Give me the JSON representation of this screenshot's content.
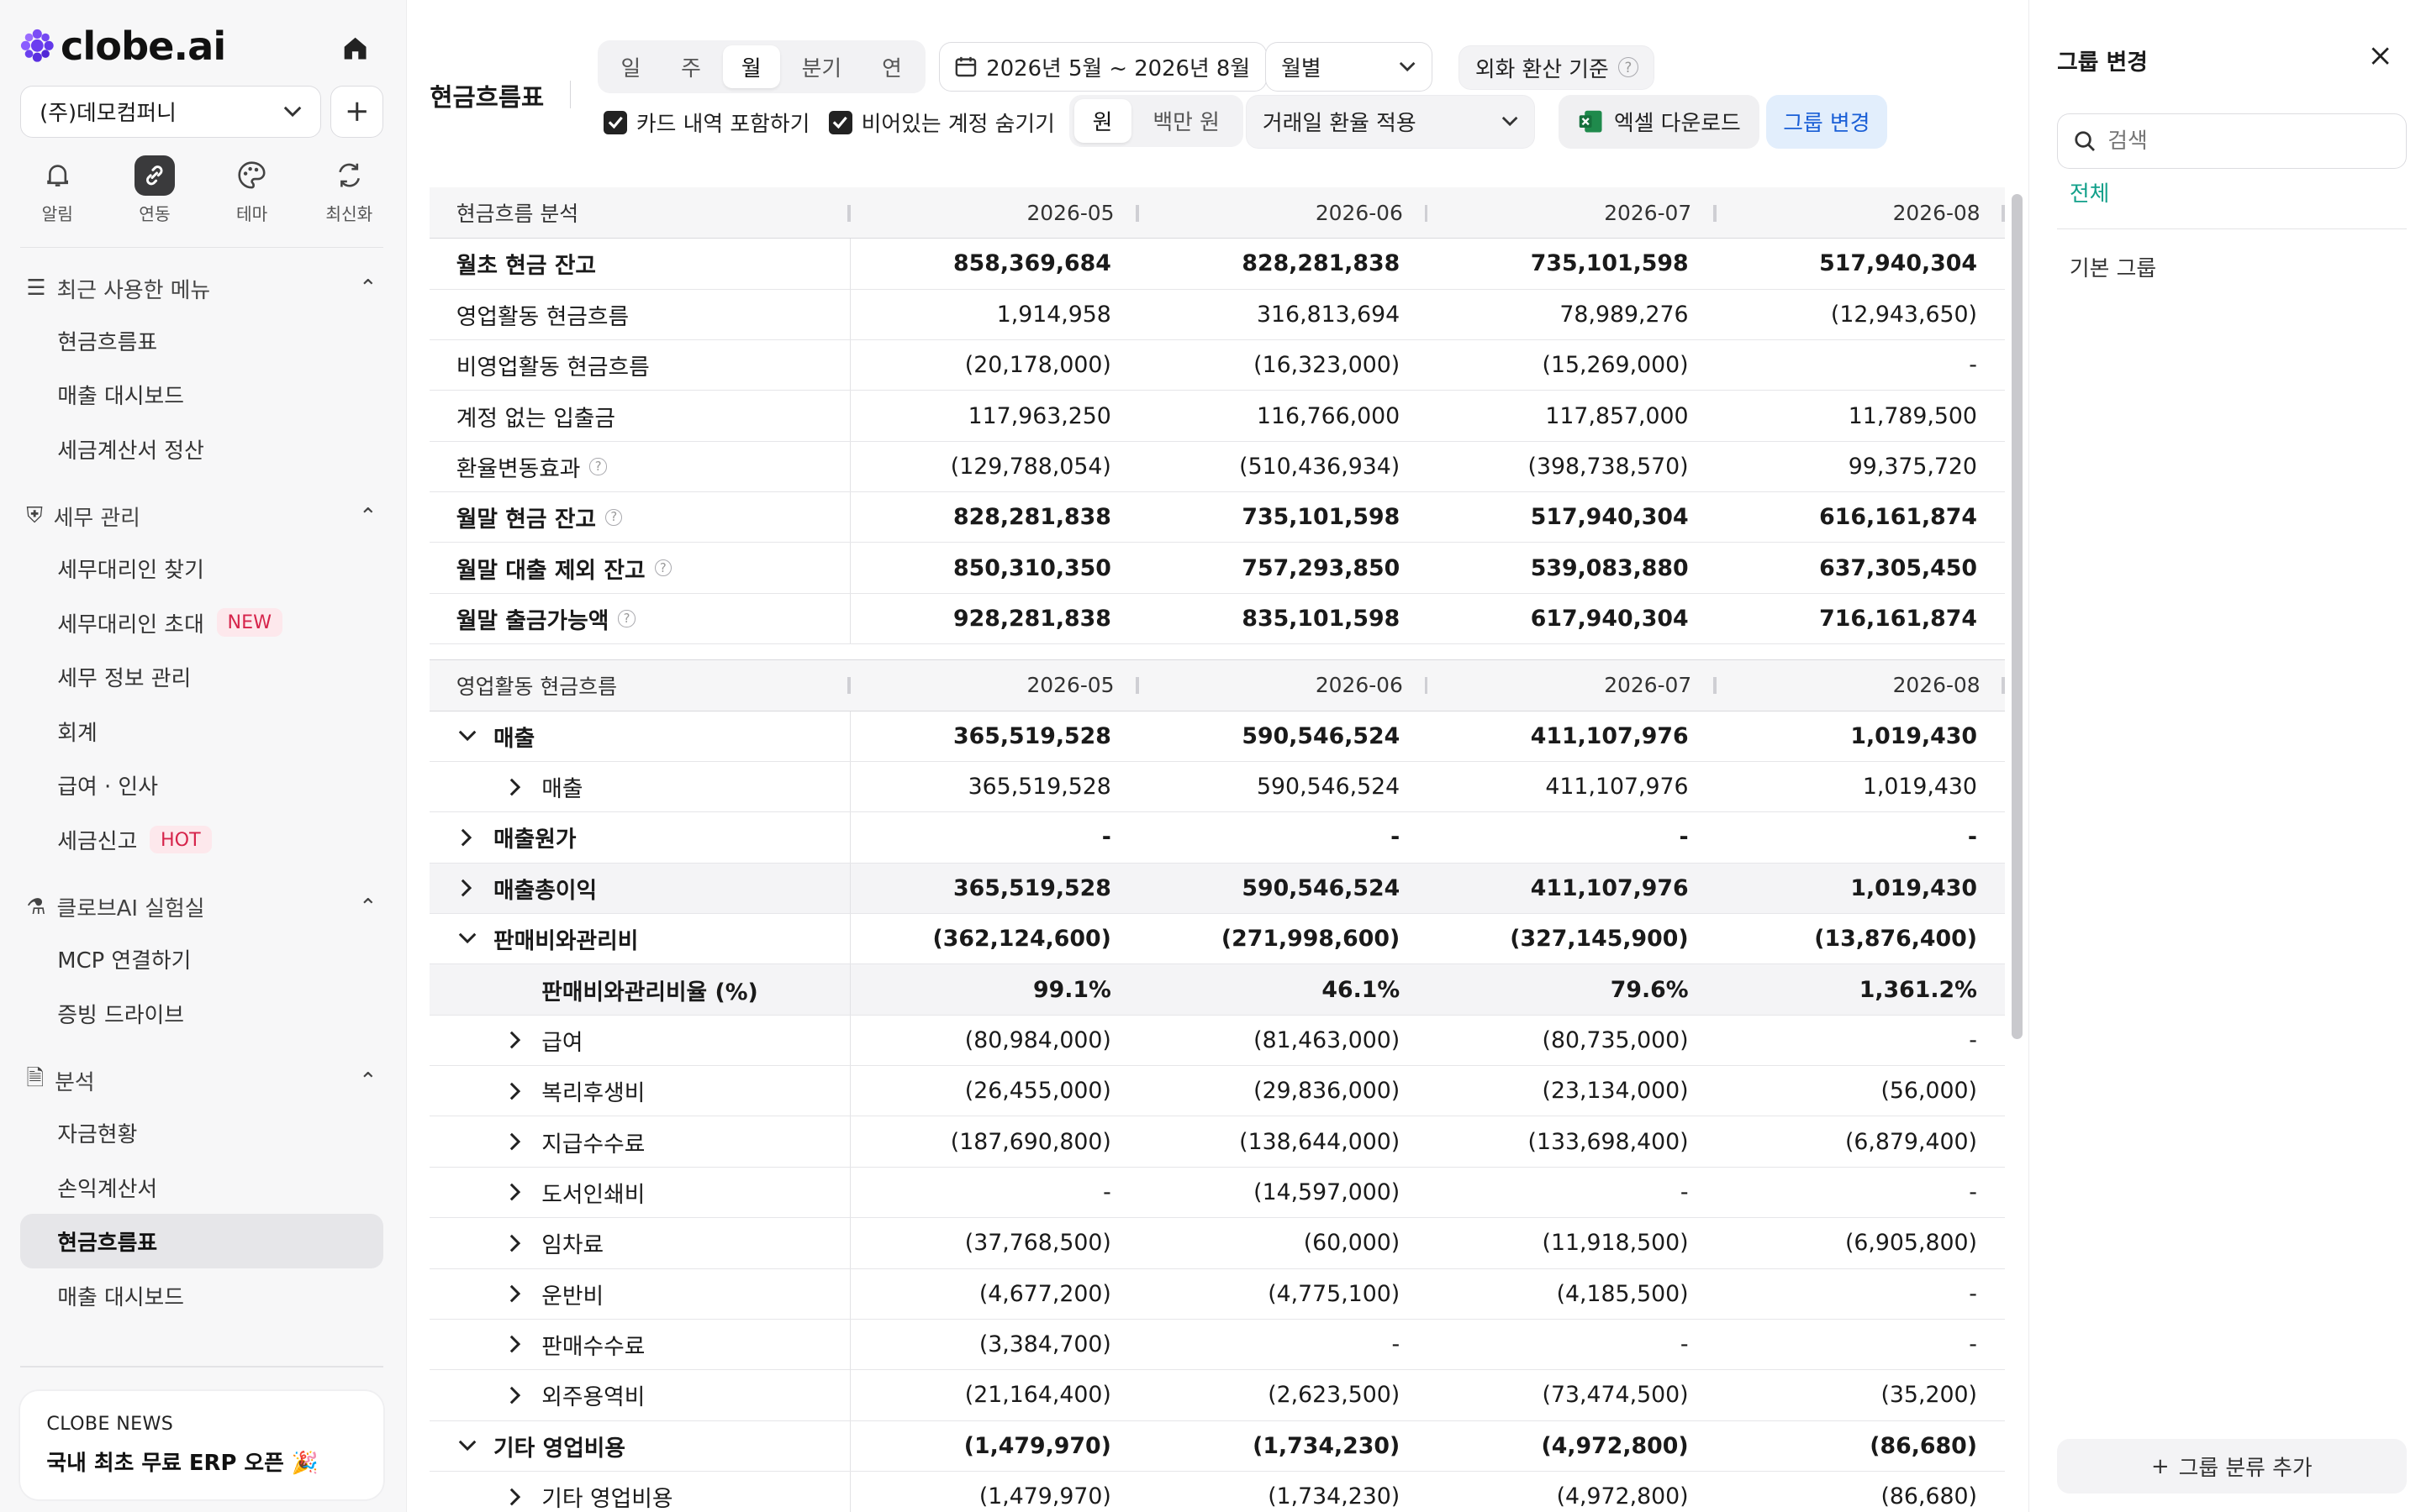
{
  "app": {
    "logo": "clobe.ai"
  },
  "sidebar": {
    "company": "(주)데모컴퍼니",
    "quick": [
      {
        "label": "알림",
        "icon": "bell-icon"
      },
      {
        "label": "연동",
        "icon": "link-icon"
      },
      {
        "label": "테마",
        "icon": "palette-icon"
      },
      {
        "label": "최신화",
        "icon": "refresh-icon"
      }
    ],
    "sections": [
      {
        "title": "최근 사용한 메뉴",
        "items": [
          {
            "label": "현금흐름표"
          },
          {
            "label": "매출 대시보드"
          },
          {
            "label": "세금계산서 정산"
          }
        ]
      },
      {
        "title": "세무 관리",
        "items": [
          {
            "label": "세무대리인 찾기"
          },
          {
            "label": "세무대리인 초대",
            "badge": "NEW"
          },
          {
            "label": "세무 정보 관리"
          },
          {
            "label": "회계"
          },
          {
            "label": "급여 · 인사"
          },
          {
            "label": "세금신고",
            "badge": "HOT"
          }
        ]
      },
      {
        "title": "클로브AI 실험실",
        "items": [
          {
            "label": "MCP 연결하기"
          },
          {
            "label": "증빙 드라이브"
          }
        ]
      },
      {
        "title": "분석",
        "items": [
          {
            "label": "자금현황"
          },
          {
            "label": "손익계산서"
          },
          {
            "label": "현금흐름표"
          },
          {
            "label": "매출 대시보드"
          }
        ]
      }
    ],
    "news": {
      "kicker": "CLOBE NEWS",
      "title": "국내 최초 무료 ERP 오픈 🎉"
    }
  },
  "toolbar": {
    "title": "현금흐름표",
    "period_tabs": [
      "일",
      "주",
      "월",
      "분기",
      "연"
    ],
    "period_selected": "월",
    "date_range": "2026년 5월 ~ 2026년 8월",
    "group_by": "월별",
    "fx_basis": "외화 환산 기준",
    "include_cards": "카드 내역 포함하기",
    "hide_empty": "비어있는 계정 숨기기",
    "unit_tabs": [
      "원",
      "백만 원"
    ],
    "unit_selected": "원",
    "fx_rate": "거래일 환율 적용",
    "excel": "엑셀 다운로드",
    "group_change": "그룹 변경"
  },
  "table": {
    "columns": [
      "2026-05",
      "2026-06",
      "2026-07",
      "2026-08"
    ],
    "summary_header": "현금흐름 분석",
    "summary": [
      {
        "label": "월초 현금 잔고",
        "bold": true,
        "values": [
          "858,369,684",
          "828,281,838",
          "735,101,598",
          "517,940,304"
        ]
      },
      {
        "label": "영업활동 현금흐름",
        "values": [
          "1,914,958",
          "316,813,694",
          "78,989,276",
          "(12,943,650)"
        ]
      },
      {
        "label": "비영업활동 현금흐름",
        "values": [
          "(20,178,000)",
          "(16,323,000)",
          "(15,269,000)",
          "-"
        ]
      },
      {
        "label": "계정 없는 입출금",
        "values": [
          "117,963,250",
          "116,766,000",
          "117,857,000",
          "11,789,500"
        ]
      },
      {
        "label": "환율변동효과",
        "help": true,
        "values": [
          "(129,788,054)",
          "(510,436,934)",
          "(398,738,570)",
          "99,375,720"
        ]
      },
      {
        "label": "월말 현금 잔고",
        "bold": true,
        "help": true,
        "values": [
          "828,281,838",
          "735,101,598",
          "517,940,304",
          "616,161,874"
        ]
      },
      {
        "label": "월말 대출 제외 잔고",
        "bold": true,
        "help": true,
        "values": [
          "850,310,350",
          "757,293,850",
          "539,083,880",
          "637,305,450"
        ]
      },
      {
        "label": "월말 출금가능액",
        "bold": true,
        "help": true,
        "values": [
          "928,281,838",
          "835,101,598",
          "617,940,304",
          "716,161,874"
        ]
      }
    ],
    "detail_header": "영업활동 현금흐름",
    "detail": [
      {
        "label": "매출",
        "level": 0,
        "chev": "down",
        "bold": true,
        "values": [
          "365,519,528",
          "590,546,524",
          "411,107,976",
          "1,019,430"
        ]
      },
      {
        "label": "매출",
        "level": 1,
        "chev": "right",
        "values": [
          "365,519,528",
          "590,546,524",
          "411,107,976",
          "1,019,430"
        ]
      },
      {
        "label": "매출원가",
        "level": 0,
        "chev": "right",
        "bold": true,
        "values": [
          "-",
          "-",
          "-",
          "-"
        ]
      },
      {
        "label": "매출총이익",
        "level": 0,
        "chev": "right",
        "bold": true,
        "shade": true,
        "values": [
          "365,519,528",
          "590,546,524",
          "411,107,976",
          "1,019,430"
        ]
      },
      {
        "label": "판매비와관리비",
        "level": 0,
        "chev": "down",
        "bold": true,
        "values": [
          "(362,124,600)",
          "(271,998,600)",
          "(327,145,900)",
          "(13,876,400)"
        ]
      },
      {
        "label": "판매비와관리비율 (%)",
        "level": 1,
        "chev": "none",
        "bold": true,
        "shade": true,
        "values": [
          "99.1%",
          "46.1%",
          "79.6%",
          "1,361.2%"
        ]
      },
      {
        "label": "급여",
        "level": 1,
        "chev": "right",
        "values": [
          "(80,984,000)",
          "(81,463,000)",
          "(80,735,000)",
          "-"
        ]
      },
      {
        "label": "복리후생비",
        "level": 1,
        "chev": "right",
        "values": [
          "(26,455,000)",
          "(29,836,000)",
          "(23,134,000)",
          "(56,000)"
        ]
      },
      {
        "label": "지급수수료",
        "level": 1,
        "chev": "right",
        "values": [
          "(187,690,800)",
          "(138,644,000)",
          "(133,698,400)",
          "(6,879,400)"
        ]
      },
      {
        "label": "도서인쇄비",
        "level": 1,
        "chev": "right",
        "values": [
          "-",
          "(14,597,000)",
          "-",
          "-"
        ]
      },
      {
        "label": "임차료",
        "level": 1,
        "chev": "right",
        "values": [
          "(37,768,500)",
          "(60,000)",
          "(11,918,500)",
          "(6,905,800)"
        ]
      },
      {
        "label": "운반비",
        "level": 1,
        "chev": "right",
        "values": [
          "(4,677,200)",
          "(4,775,100)",
          "(4,185,500)",
          "-"
        ]
      },
      {
        "label": "판매수수료",
        "level": 1,
        "chev": "right",
        "values": [
          "(3,384,700)",
          "-",
          "-",
          "-"
        ]
      },
      {
        "label": "외주용역비",
        "level": 1,
        "chev": "right",
        "values": [
          "(21,164,400)",
          "(2,623,500)",
          "(73,474,500)",
          "(35,200)"
        ]
      },
      {
        "label": "기타 영업비용",
        "level": 0,
        "chev": "down",
        "bold": true,
        "values": [
          "(1,479,970)",
          "(1,734,230)",
          "(4,972,800)",
          "(86,680)"
        ]
      },
      {
        "label": "기타 영업비용",
        "level": 1,
        "chev": "right",
        "values": [
          "(1,479,970)",
          "(1,734,230)",
          "(4,972,800)",
          "(86,680)"
        ]
      }
    ]
  },
  "panel": {
    "title": "그룹 변경",
    "search_placeholder": "검색",
    "tab_all": "전체",
    "items": [
      "기본 그룹"
    ],
    "add_label": "그룹 분류 추가"
  },
  "colors": {
    "accent_blue": "#1a5fd6",
    "teal": "#12a08a",
    "badge_red": "#d6244b"
  }
}
